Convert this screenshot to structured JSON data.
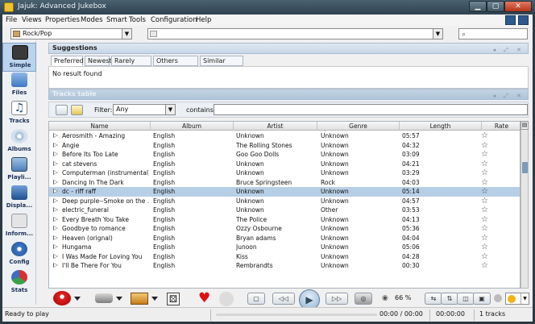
{
  "window": {
    "title": "Jajuk: Advanced Jukebox"
  },
  "menu": {
    "items": [
      {
        "label": "File",
        "mnemonic": "F"
      },
      {
        "label": "Views",
        "mnemonic": "V"
      },
      {
        "label": "Properties",
        "mnemonic": "P"
      },
      {
        "label": "Modes",
        "mnemonic": "M"
      },
      {
        "label": "Smart",
        "mnemonic": "S"
      },
      {
        "label": "Tools",
        "mnemonic": "T"
      },
      {
        "label": "Configuration",
        "mnemonic": "C"
      },
      {
        "label": "Help",
        "mnemonic": "H"
      }
    ]
  },
  "searchbar": {
    "ambience": "Rock/Pop",
    "history": "",
    "search": ""
  },
  "perspectives": [
    {
      "label": "Simple",
      "icon": "simple-icon",
      "active": true
    },
    {
      "label": "Files",
      "icon": "files-icon"
    },
    {
      "label": "Tracks",
      "icon": "tracks-icon"
    },
    {
      "label": "Albums",
      "icon": "albums-icon"
    },
    {
      "label": "Playli...",
      "icon": "playlist-icon"
    },
    {
      "label": "Displa...",
      "icon": "display-icon"
    },
    {
      "label": "Inform...",
      "icon": "information-icon"
    },
    {
      "label": "Config",
      "icon": "config-icon"
    },
    {
      "label": "Stats",
      "icon": "stats-icon"
    }
  ],
  "suggestions": {
    "title": "Suggestions",
    "tabs": [
      "Preferred",
      "Newest",
      "Rarely listen",
      "Others albums",
      "Similar artists"
    ],
    "selected_tab": "Preferred",
    "message": "No result found"
  },
  "tracks_panel": {
    "title": "Tracks table",
    "filter_label": "Filter:",
    "filter_value": "Any",
    "contains_label": "contains:",
    "contains_value": ""
  },
  "table": {
    "columns": [
      "Name",
      "Album",
      "Artist",
      "Genre",
      "Length",
      "Rate"
    ],
    "rows": [
      {
        "name": "Aerosmith - Amazing",
        "album": "English",
        "artist": "Unknown",
        "genre": "Unknown",
        "length": "05:57"
      },
      {
        "name": "Angie",
        "album": "English",
        "artist": "The Rolling Stones",
        "genre": "Unknown",
        "length": "04:32"
      },
      {
        "name": "Before Its Too Late",
        "album": "English",
        "artist": "Goo Goo Dolls",
        "genre": "Unknown",
        "length": "03:09"
      },
      {
        "name": "cat stevens",
        "album": "English",
        "artist": "Unknown",
        "genre": "Unknown",
        "length": "04:21"
      },
      {
        "name": "Computerman (instrumental)",
        "album": "English",
        "artist": "Unknown",
        "genre": "Unknown",
        "length": "03:29"
      },
      {
        "name": "Dancing In The Dark",
        "album": "English",
        "artist": "Bruce Springsteen",
        "genre": "Rock",
        "length": "04:03"
      },
      {
        "name": "dc - riff raff",
        "album": "English",
        "artist": "Unknown",
        "genre": "Unknown",
        "length": "05:14",
        "selected": true
      },
      {
        "name": "Deep purple--Smoke on the ...",
        "album": "English",
        "artist": "Unknown",
        "genre": "Unknown",
        "length": "04:57"
      },
      {
        "name": "electric_funeral",
        "album": "English",
        "artist": "Unknown",
        "genre": "Other",
        "length": "03:53"
      },
      {
        "name": "Every Breath You Take",
        "album": "English",
        "artist": "The Police",
        "genre": "Unknown",
        "length": "04:13"
      },
      {
        "name": "Goodbye to romance",
        "album": "English",
        "artist": "Ozzy Osbourne",
        "genre": "Unknown",
        "length": "05:36"
      },
      {
        "name": "Heaven (orignal)",
        "album": "English",
        "artist": "Bryan adams",
        "genre": "Unknown",
        "length": "04:04"
      },
      {
        "name": "Hungama",
        "album": "English",
        "artist": "Junoon",
        "genre": "Unknown",
        "length": "05:06"
      },
      {
        "name": "I Was Made For Loving You",
        "album": "English",
        "artist": "Kiss",
        "genre": "Unknown",
        "length": "04:28"
      },
      {
        "name": "I'll Be There For You",
        "album": "English",
        "artist": "Rembrandts",
        "genre": "Unknown",
        "length": "00:30"
      }
    ]
  },
  "player": {
    "volume": "66 %",
    "volume_level": 0.66
  },
  "status": {
    "message": "Ready to play",
    "position": "00:00 / 00:00",
    "total": "00:00:00",
    "tracks": "1 tracks"
  },
  "colors": {
    "selection": "#b7cfe6",
    "accent": "#2d5a8a"
  }
}
